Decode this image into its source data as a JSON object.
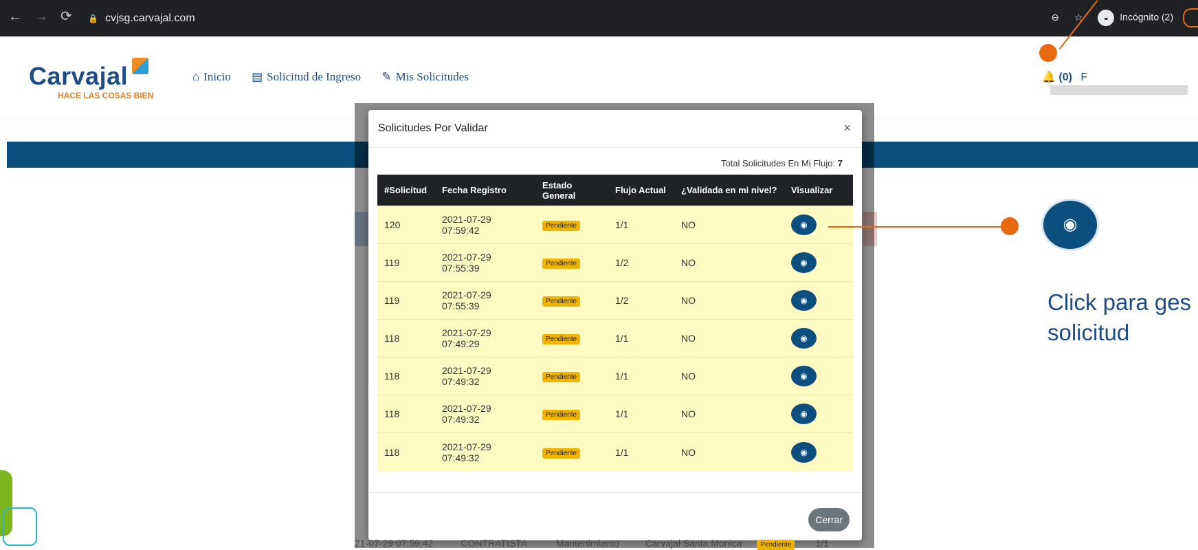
{
  "browser": {
    "url": "cvjsg.carvajal.com",
    "incognito_label": "Incógnito (2)"
  },
  "header": {
    "logo_text": "Carvajal",
    "logo_tagline": "HACE LAS COSAS BIEN",
    "nav": [
      {
        "label": "Inicio"
      },
      {
        "label": "Solicitud de Ingreso"
      },
      {
        "label": "Mis Solicitudes"
      }
    ],
    "notifications_label": "(0)",
    "user_initial": "F"
  },
  "modal": {
    "title": "Solicitudes Por Validar",
    "close_symbol": "×",
    "total_label": "Total Solicitudes En Mi Flujo:",
    "total_value": "7",
    "columns": [
      "#Solicitud",
      "Fecha Registro",
      "Estado General",
      "Flujo Actual",
      "¿Validada en mi nivel?",
      "Visualizar"
    ],
    "rows": [
      {
        "id": "120",
        "fecha": "2021-07-29 07:59:42",
        "estado": "Pendiente",
        "flujo": "1/1",
        "validada": "NO"
      },
      {
        "id": "119",
        "fecha": "2021-07-29 07:55:39",
        "estado": "Pendiente",
        "flujo": "1/2",
        "validada": "NO"
      },
      {
        "id": "119",
        "fecha": "2021-07-29 07:55:39",
        "estado": "Pendiente",
        "flujo": "1/2",
        "validada": "NO"
      },
      {
        "id": "118",
        "fecha": "2021-07-29 07:49:29",
        "estado": "Pendiente",
        "flujo": "1/1",
        "validada": "NO"
      },
      {
        "id": "118",
        "fecha": "2021-07-29 07:49:32",
        "estado": "Pendiente",
        "flujo": "1/1",
        "validada": "NO"
      },
      {
        "id": "118",
        "fecha": "2021-07-29 07:49:32",
        "estado": "Pendiente",
        "flujo": "1/1",
        "validada": "NO"
      },
      {
        "id": "118",
        "fecha": "2021-07-29 07:49:32",
        "estado": "Pendiente",
        "flujo": "1/1",
        "validada": "NO"
      }
    ],
    "close_button_label": "Cerrar"
  },
  "background": {
    "bottom_row": [
      "21-07-29 07:59:42",
      "CONTRATISTA",
      "Mantenimiento",
      "Carvajal Santa Monica",
      "Pendiente",
      "1/1"
    ]
  },
  "annotation": {
    "text_line1": "Click para ges",
    "text_line2": "solicitud"
  },
  "colors": {
    "brand_blue": "#0c4f7e",
    "row_highlight": "#fff9c2",
    "badge_pending": "#f0b400",
    "annotation_orange": "#e86a10"
  }
}
